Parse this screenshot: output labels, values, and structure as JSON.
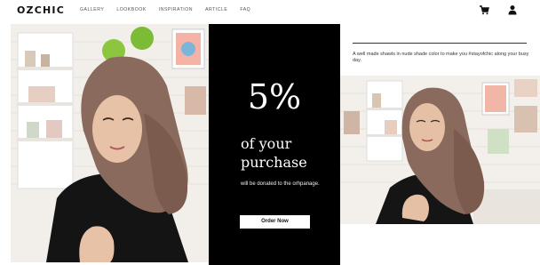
{
  "header": {
    "logo": "OZCHIC",
    "nav": [
      "GALLERY",
      "LOOKBOOK",
      "INSPIRATION",
      "ARTICLE",
      "FAQ"
    ]
  },
  "promo": {
    "percent": "5%",
    "line1": "of your",
    "line2": "purchase",
    "donation_text": "will be donated to the orhpanage.",
    "button_label": "Order Now"
  },
  "aside": {
    "tagline": "A well made shawls in nude shade color to make you #stayofchic along your busy day."
  },
  "colors": {
    "promo_bg": "#000000",
    "shawl": "#8a6a5c",
    "page_bg": "#ffffff"
  },
  "icons": [
    "cart-icon",
    "user-icon"
  ]
}
